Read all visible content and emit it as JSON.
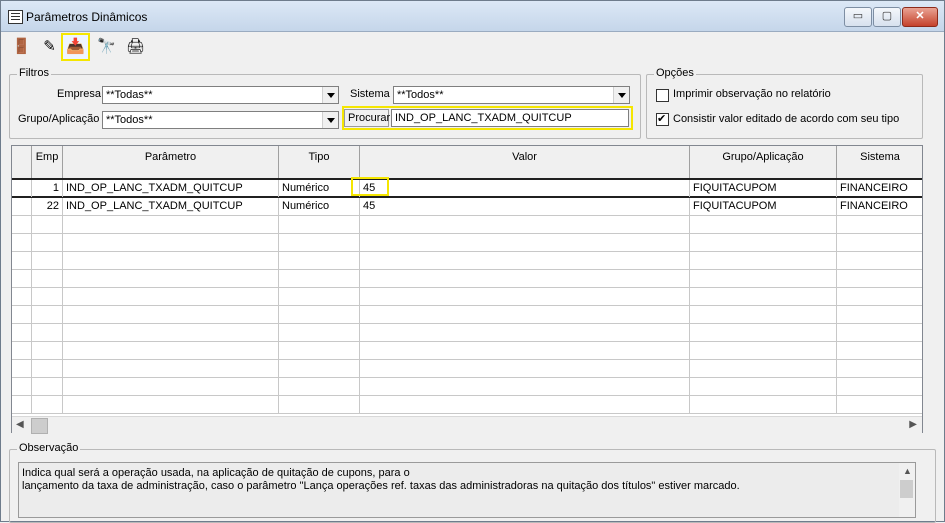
{
  "window": {
    "title": "Parâmetros Dinâmicos",
    "min_glyph": "▭",
    "max_glyph": "▢",
    "close_glyph": "✕"
  },
  "toolbar": {
    "buttons": [
      {
        "name": "exit-button",
        "icon": "door-exit-icon",
        "glyph": "🚪"
      },
      {
        "name": "edit-button",
        "icon": "pencil-icon",
        "glyph": "✎"
      },
      {
        "name": "import-button",
        "icon": "tray-download-icon",
        "glyph": "📥"
      },
      {
        "name": "search-button",
        "icon": "binoculars-icon",
        "glyph": "🔭"
      },
      {
        "name": "print-button",
        "icon": "printer-icon",
        "glyph": "🖨"
      }
    ]
  },
  "filters": {
    "legend": "Filtros",
    "empresa_label": "Empresa",
    "empresa_value": "**Todas**",
    "grupo_label": "Grupo/Aplicação",
    "grupo_value": "**Todos**",
    "sistema_label": "Sistema",
    "sistema_value": "**Todos**",
    "procurar_label": "Procurar",
    "procurar_value": "IND_OP_LANC_TXADM_QUITCUP"
  },
  "options": {
    "legend": "Opções",
    "imprimir_label": "Imprimir observação no relatório",
    "imprimir_checked": false,
    "consistir_label": "Consistir valor editado de acordo com seu tipo",
    "consistir_checked": true
  },
  "grid": {
    "columns": [
      "Emp",
      "Parâmetro",
      "Tipo",
      "Valor",
      "Grupo/Aplicação",
      "Sistema"
    ],
    "rows": [
      {
        "emp": "1",
        "parametro": "IND_OP_LANC_TXADM_QUITCUP",
        "tipo": "Numérico",
        "valor": "45",
        "grupo": "FIQUITACUPOM",
        "sistema": "FINANCEIRO"
      },
      {
        "emp": "22",
        "parametro": "IND_OP_LANC_TXADM_QUITCUP",
        "tipo": "Numérico",
        "valor": "45",
        "grupo": "FIQUITACUPOM",
        "sistema": "FINANCEIRO"
      }
    ]
  },
  "observacao": {
    "legend": "Observação",
    "line1": "Indica qual será a operação usada, na aplicação de quitação de cupons, para o",
    "line2": "lançamento da taxa de administração, caso o parâmetro \"Lança operações ref. taxas das administradoras na quitação dos títulos\" estiver marcado."
  }
}
